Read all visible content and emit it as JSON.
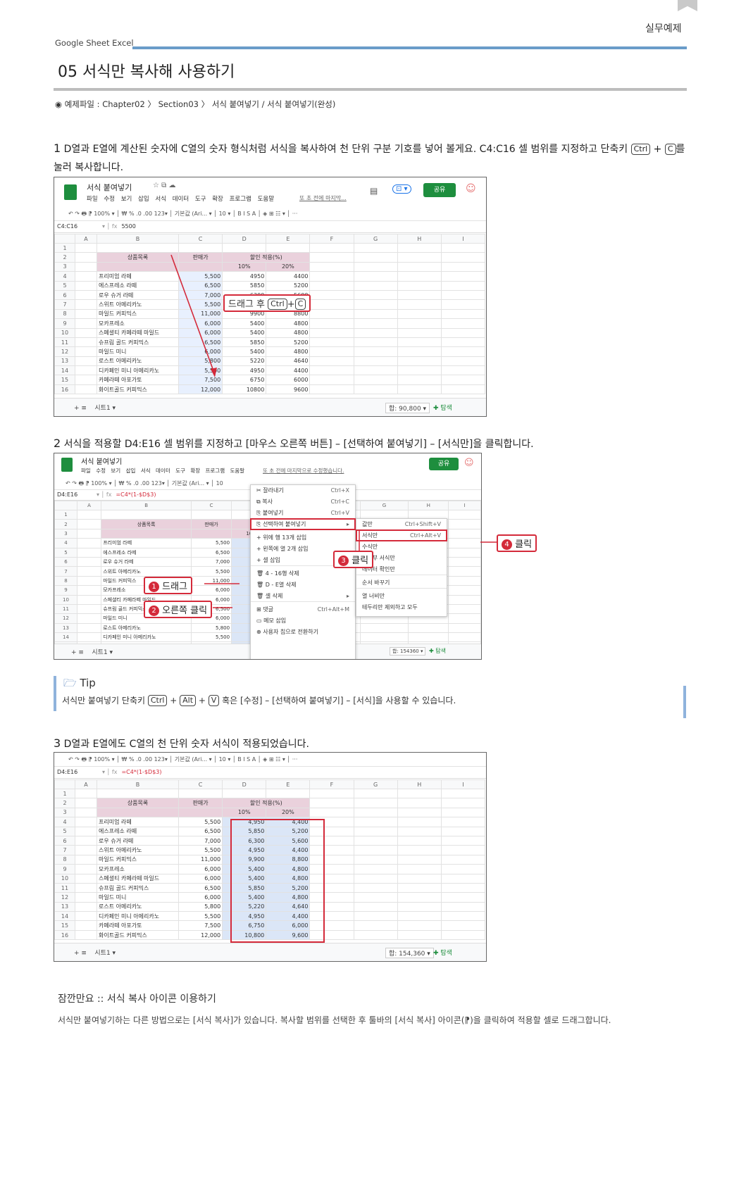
{
  "page": {
    "running_head": "실무예제",
    "crumbs": "Google Sheet  Excel",
    "title": "05 서식만 복사해 사용하기",
    "source": "◉ 예제파일 : Chapter02 〉 Section03 〉 서식 붙여넣기 / 서식 붙여넣기(완성)"
  },
  "steps": {
    "s1_num": "1",
    "s1_a": " D열과 E열에 계산된 숫자에 C열의 숫자 형식처럼 서식을 복사하여 천 단위 구분 기호를 넣어 볼게요. C4:C16 셀 범위를 지정하고 단축키 ",
    "s1_b": "를 눌러 복사합니다.",
    "s2_num": "2",
    "s2_text": " 서식을 적용할 D4:E16 셀 범위를 지정하고 [마우스 오른쪽 버튼] – [선택하여 붙여넣기] – [서식만]을 클릭합니다.",
    "s3_num": "3",
    "s3_text": " D열과 E열에도 C열의 천 단위 숫자 서식이 적용되었습니다."
  },
  "keys": {
    "ctrl": "Ctrl",
    "c": "C",
    "alt": "Alt",
    "v": "V",
    "plus": "+"
  },
  "sheet": {
    "doc_title": "서식 붙여넣기",
    "menus": [
      "파일",
      "수정",
      "보기",
      "삽입",
      "서식",
      "데이터",
      "도구",
      "확장 프로그램",
      "도움말"
    ],
    "last_edit1": "또 초 전에 마지막...",
    "last_edit2": "또 초 전에 마지막으로 수정했습니다.",
    "share": "공유",
    "toolbar": "↶  ↷  🖶  ⁋     100% ▾  │  ₩   %   .0   .00   123▾  │  기본값 (Ari... ▾  │  10  ▾  │  B   I   S   A  │  ◈  ⊞  ☷ ▾  │  ···",
    "toolbar2": "↶  ↷  🖶  ⁋     100% ▾  │  ₩   %   .0   .00   123▾  │  기본값 (Ari... ▾  │  10",
    "ref1": "C4:C16",
    "fx1": "5500",
    "ref2": "D4:E16",
    "fx2": "=C4*(1-$D$3)",
    "ref3": "D4:E16",
    "fx3": "=C4*(1-$D$3)",
    "cols": [
      "A",
      "B",
      "C",
      "D",
      "E",
      "F",
      "G",
      "H",
      "I"
    ],
    "h_product": "상품목록",
    "h_product2": "상품목록",
    "h_price": "판매가",
    "h_discount": "할인 적용(%)",
    "h_10": "10%",
    "h_20": "20%",
    "rows": [
      {
        "n": "4",
        "b": "프리미엄 라떼",
        "c": "5,500",
        "d": "4950",
        "e": "4400",
        "df": "4,950",
        "ef": "4,400"
      },
      {
        "n": "5",
        "b": "에스프레소 라떼",
        "c": "6,500",
        "d": "5850",
        "e": "5200",
        "df": "5,850",
        "ef": "5,200"
      },
      {
        "n": "6",
        "b": "로우 슈거 라떼",
        "c": "7,000",
        "d": "6300",
        "e": "5600",
        "df": "6,300",
        "ef": "5,600"
      },
      {
        "n": "7",
        "b": "스위트 아메리카노",
        "c": "5,500",
        "d": "4950",
        "e": "4400",
        "df": "4,950",
        "ef": "4,400"
      },
      {
        "n": "8",
        "b": "마일드 커피믹스",
        "c": "11,000",
        "d": "9900",
        "e": "8800",
        "df": "9,900",
        "ef": "8,800"
      },
      {
        "n": "9",
        "b": "모카프레소",
        "c": "6,000",
        "d": "5400",
        "e": "4800",
        "df": "5,400",
        "ef": "4,800"
      },
      {
        "n": "10",
        "b": "스페셜티 카페라떼 마일드",
        "c": "6,000",
        "d": "5400",
        "e": "4800",
        "df": "5,400",
        "ef": "4,800"
      },
      {
        "n": "11",
        "b": "슈프림 골드 커피믹스",
        "c": "6,500",
        "d": "5850",
        "e": "5200",
        "df": "5,850",
        "ef": "5,200"
      },
      {
        "n": "12",
        "b": "마일드 미니",
        "c": "6,000",
        "d": "5400",
        "e": "4800",
        "df": "5,400",
        "ef": "4,800"
      },
      {
        "n": "13",
        "b": "로스트 아메리카노",
        "c": "5,800",
        "d": "5220",
        "e": "4640",
        "df": "5,220",
        "ef": "4,640"
      },
      {
        "n": "14",
        "b": "디카페인 미니 아메리카노",
        "c": "5,500",
        "d": "4950",
        "e": "4400",
        "df": "4,950",
        "ef": "4,400"
      },
      {
        "n": "15",
        "b": "카페라떼 아포가토",
        "c": "7,500",
        "d": "6750",
        "e": "6000",
        "df": "6,750",
        "ef": "6,000"
      },
      {
        "n": "16",
        "b": "화이트골드 커피믹스",
        "c": "12,000",
        "d": "10800",
        "e": "9600",
        "df": "10,800",
        "ef": "9,600"
      }
    ],
    "sheet_tab": "시트1 ▾",
    "sum1": "합: 90,800 ▾",
    "sum2": "합: 154360 ▾",
    "sum3": "합: 154,360 ▾",
    "explore": "탐색"
  },
  "callouts": {
    "drag_copy": "드래그 후",
    "drag": "드래그",
    "right_click": "오른쪽 클릭",
    "click3": "클릭",
    "click4": "클릭",
    "n1": "1",
    "n2": "2",
    "n3": "3",
    "n4": "4"
  },
  "context_menu": [
    {
      "label": "✂  잘라내기",
      "sc": "Ctrl+X"
    },
    {
      "label": "⧉  복사",
      "sc": "Ctrl+C"
    },
    {
      "label": "⎘  붙여넣기",
      "sc": "Ctrl+V"
    },
    {
      "label": "⎘  선택하여 붙여넣기",
      "sc": "▸"
    },
    {
      "label": "+  위에 행 13개 삽입",
      "sc": ""
    },
    {
      "label": "+  왼쪽에 열 2개 삽입",
      "sc": ""
    },
    {
      "label": "+  셀 삽입",
      "sc": ""
    },
    {
      "label": "🗑  4 - 16행 삭제",
      "sc": ""
    },
    {
      "label": "🗑  D - E열 삭제",
      "sc": ""
    },
    {
      "label": "🗑  셀 삭제",
      "sc": "▸"
    },
    {
      "label": "⊞  댓글",
      "sc": "Ctrl+Alt+M"
    },
    {
      "label": "▭  메모 삽입",
      "sc": ""
    },
    {
      "label": "⊕  사용자 칩으로 전환하기",
      "sc": ""
    }
  ],
  "submenu": [
    {
      "label": "값만",
      "sc": "Ctrl+Shift+V"
    },
    {
      "label": "서식만",
      "sc": "Ctrl+Alt+V"
    },
    {
      "label": "수식만",
      "sc": ""
    },
    {
      "label": "조건부 서식만",
      "sc": ""
    },
    {
      "label": "데이터 확인만",
      "sc": ""
    },
    {
      "label": "순서 바꾸기",
      "sc": ""
    },
    {
      "label": "열 너비만",
      "sc": ""
    },
    {
      "label": "테두리만 제외하고 모두",
      "sc": ""
    }
  ],
  "tip": {
    "title": "Tip",
    "text_a": "서식만 붙여넣기 단축키 ",
    "text_b": " 혹은 [수정] – [선택하여 붙여넣기] – [서식]을 사용할 수 있습니다."
  },
  "note": {
    "title": "잠깐만요 :: 서식 복사 아이콘 이용하기",
    "text": "서식만 붙여넣기하는 다른 방법으로는 [서식 복사]가 있습니다. 복사할 범위를 선택한 후 툴바의 [서식 복사] 아이콘(⁋)을 클릭하여 적용할 셀로 드래그합니다."
  },
  "colors": {
    "accent_blue": "#6a9cc9",
    "red": "#d42a3a",
    "header_pink": "#ead1dc",
    "sheets_green": "#1e8e3e"
  }
}
